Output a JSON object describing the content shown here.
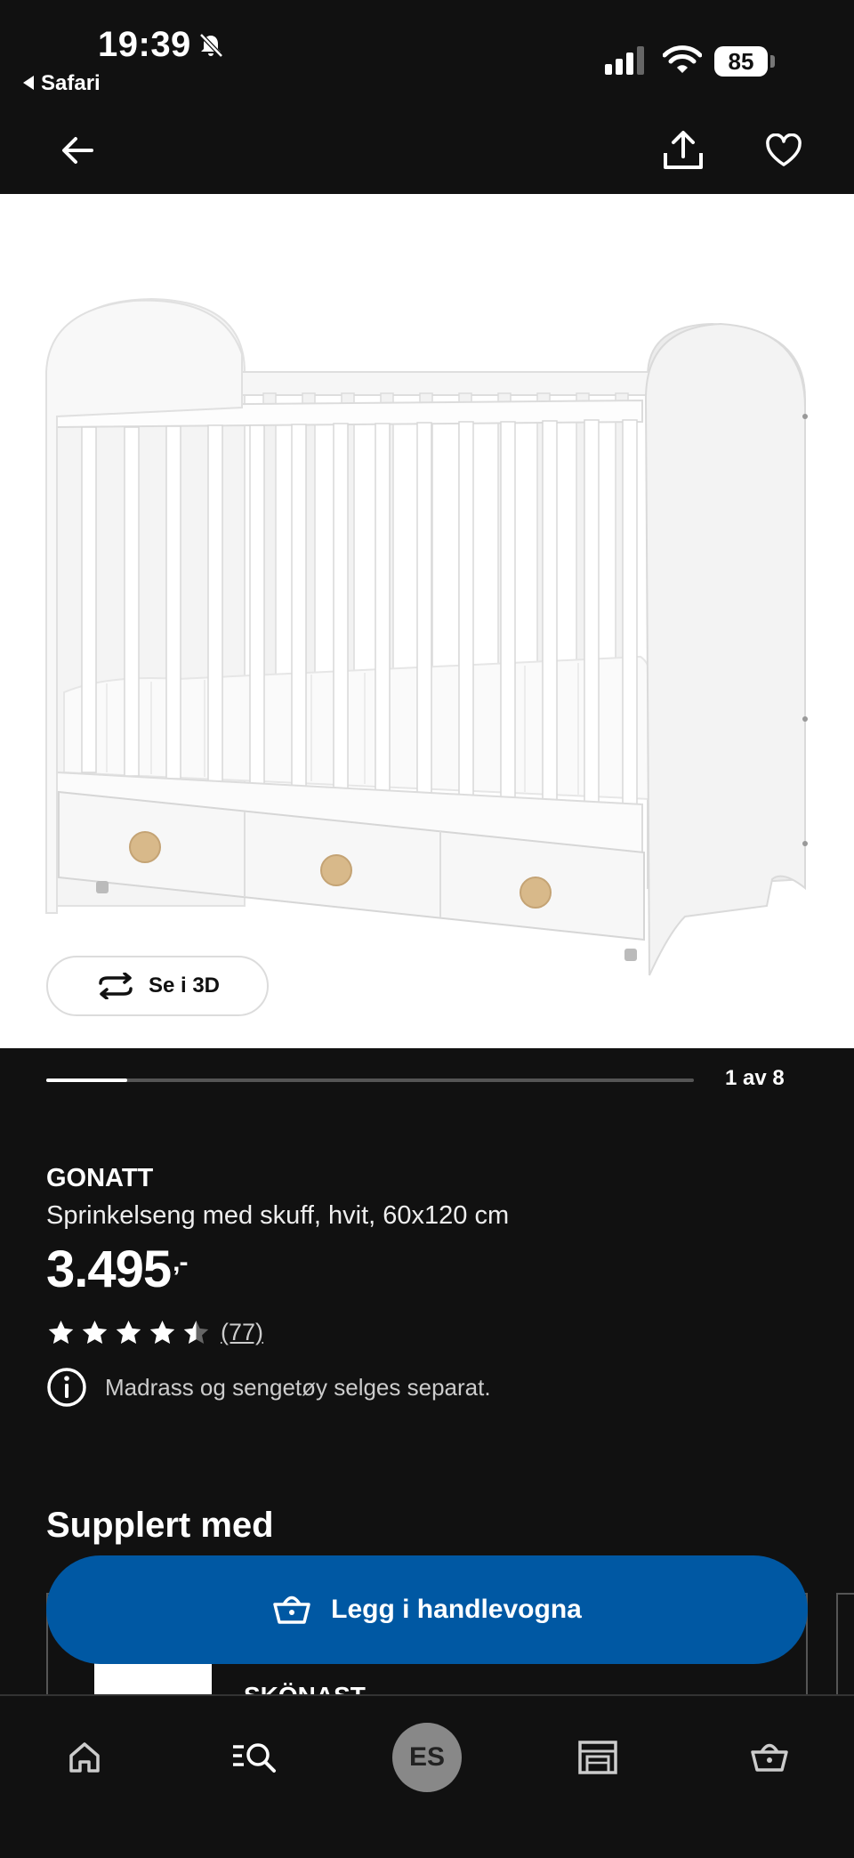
{
  "status_bar": {
    "time": "19:39",
    "back_app": "Safari",
    "battery": "85"
  },
  "gallery": {
    "view_3d_label": "Se i 3D",
    "counter": "1 av 8",
    "progress": 0.125
  },
  "product": {
    "brand": "GONATT",
    "description": "Sprinkelseng med skuff, hvit, 60x120 cm",
    "price": "3.495",
    "price_suffix": ",-",
    "rating": 4.5,
    "reviews": "(77)",
    "info": "Madrass og sengetøy selges separat."
  },
  "complements": {
    "title": "Supplert med",
    "card_text": "SKÖNAST"
  },
  "cta": {
    "label": "Legg i handlevogna"
  },
  "tabbar": {
    "avatar": "ES"
  },
  "colors": {
    "background": "#111111",
    "accent": "#0058a3",
    "wood": "#d8b98a"
  }
}
